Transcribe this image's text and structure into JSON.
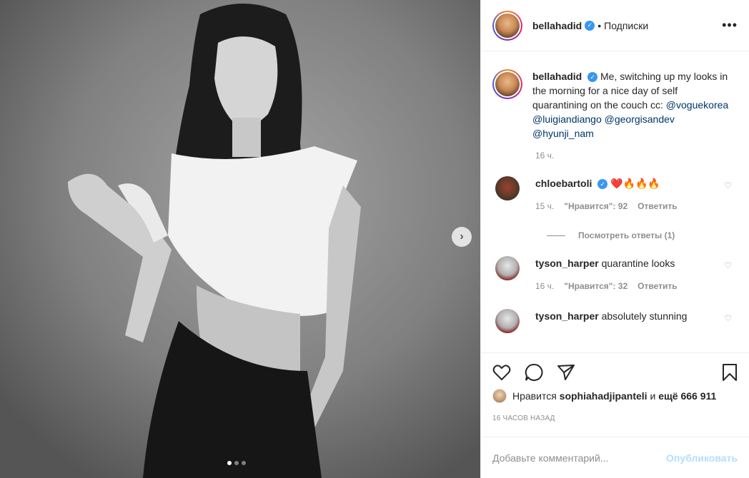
{
  "post": {
    "username": "bellahadid",
    "follow_label": "Подписки",
    "separator": "•",
    "more_label": "•••",
    "next_label": "›",
    "caption": {
      "username": "bellahadid",
      "text": "Me, switching up my looks in the morning for a nice day of self quarantining on the couch cc: ",
      "mentions": "@voguekorea @luigiandiango @georgisandev @hyunji_nam",
      "time": "16 ч."
    },
    "comments": [
      {
        "username": "chloebartoli",
        "text": "❤️🔥🔥🔥",
        "time": "15 ч.",
        "likes": "\"Нравится\": 92",
        "reply": "Ответить",
        "view_replies": "Посмотреть ответы (1)"
      },
      {
        "username": "tyson_harper",
        "text": "quarantine looks",
        "time": "16 ч.",
        "likes": "\"Нравится\": 32",
        "reply": "Ответить"
      },
      {
        "username": "tyson_harper",
        "text": "absolutely stunning"
      }
    ],
    "likes_line": {
      "prefix": "Нравится",
      "user": "sophiahadjipanteli",
      "middle": "и",
      "others": "ещё 666 911"
    },
    "posted_ago": "16 ЧАСОВ НАЗАД",
    "comment_box": {
      "placeholder": "Добавьте комментарий...",
      "publish": "Опубликовать"
    }
  },
  "carousel": {
    "slides": 3,
    "active": 1
  },
  "colors": {
    "link": "#003569",
    "muted": "#8e8e8e",
    "verified": "#3897f0",
    "publish_disabled": "#b2dffc",
    "heart": "#ed4956"
  },
  "icons": [
    "verified-icon",
    "heart-icon",
    "comment-icon",
    "share-icon",
    "bookmark-icon",
    "chevron-right-icon",
    "more-icon"
  ]
}
